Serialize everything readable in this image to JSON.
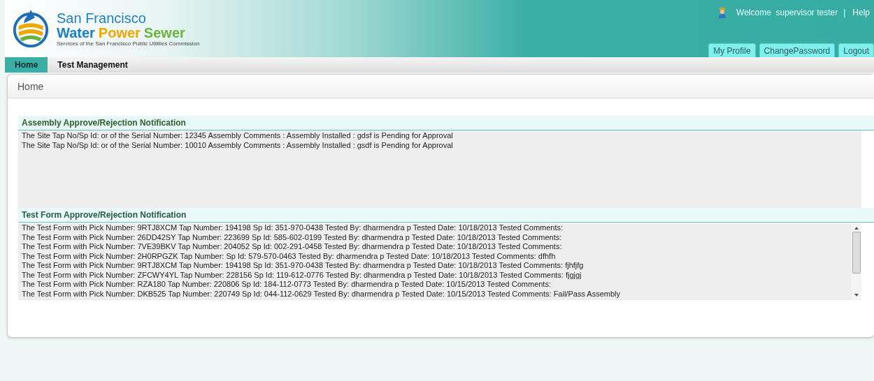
{
  "header": {
    "logo": {
      "line1": "San Francisco",
      "words": [
        {
          "text": "Water",
          "color": "#1f7fc4"
        },
        {
          "text": "Power",
          "color": "#f0a800"
        },
        {
          "text": "Sewer",
          "color": "#6bb33a"
        }
      ],
      "tagline": "Services of the San Francisco Public Utilities Commission"
    },
    "welcome": "Welcome  supervisor tester",
    "separator": "|",
    "help": "Help",
    "user_tabs": [
      "My Profile",
      "ChangePassword",
      "Logout"
    ]
  },
  "nav": [
    {
      "label": "Home",
      "selected": true
    },
    {
      "label": "Test Management",
      "selected": false
    }
  ],
  "breadcrumb": "Home",
  "sections": [
    {
      "title": "Assembly Approve/Rejection Notification",
      "scrollable": false,
      "lines": [
        "The Site Tap No/Sp Id: or of the Serial Number: 12345 Assembly Comments : Assembly Installed : gdsf is Pending for Approval",
        "The Site Tap No/Sp Id: or of the Serial Number: 10010 Assembly Comments : Assembly Installed : gsdf is Pending for Approval"
      ]
    },
    {
      "title": "Test Form Approve/Rejection Notification",
      "scrollable": true,
      "lines": [
        "The Test Form with Pick Number: 9RTJ8XCM Tap Number: 194198 Sp Id: 351-970-0438 Tested By: dharmendra p Tested Date: 10/18/2013 Tested Comments:",
        "The Test Form with Pick Number: 26DD42SY Tap Number: 223699 Sp Id: 585-602-0199 Tested By: dharmendra p Tested Date: 10/18/2013 Tested Comments:",
        "The Test Form with Pick Number: 7VE39BKV Tap Number: 204052 Sp Id: 002-291-0458 Tested By: dharmendra p Tested Date: 10/18/2013 Tested Comments:",
        "The Test Form with Pick Number: 2H0RPGZK Tap Number: Sp Id: 579-570-0463 Tested By: dharmendra p Tested Date: 10/18/2013 Tested Comments: dfhfh",
        "The Test Form with Pick Number: 9RTJ8XCM Tap Number: 194198 Sp Id: 351-970-0438 Tested By: dharmendra p Tested Date: 10/18/2013 Tested Comments: fjhfjfg",
        "The Test Form with Pick Number: ZFCWY4YL Tap Number: 228156 Sp Id: 119-612-0776 Tested By: dharmendra p Tested Date: 10/18/2013 Tested Comments: fjgjgj",
        "The Test Form with Pick Number: RZA180 Tap Number: 220806 Sp Id: 184-112-0773 Tested By: dharmendra p Tested Date: 10/15/2013 Tested Comments:",
        "The Test Form with Pick Number: DKB525 Tap Number: 220749 Sp Id: 044-112-0629 Tested By: dharmendra p Tested Date: 10/15/2013 Tested Comments: Fail/Pass Assembly"
      ]
    }
  ]
}
